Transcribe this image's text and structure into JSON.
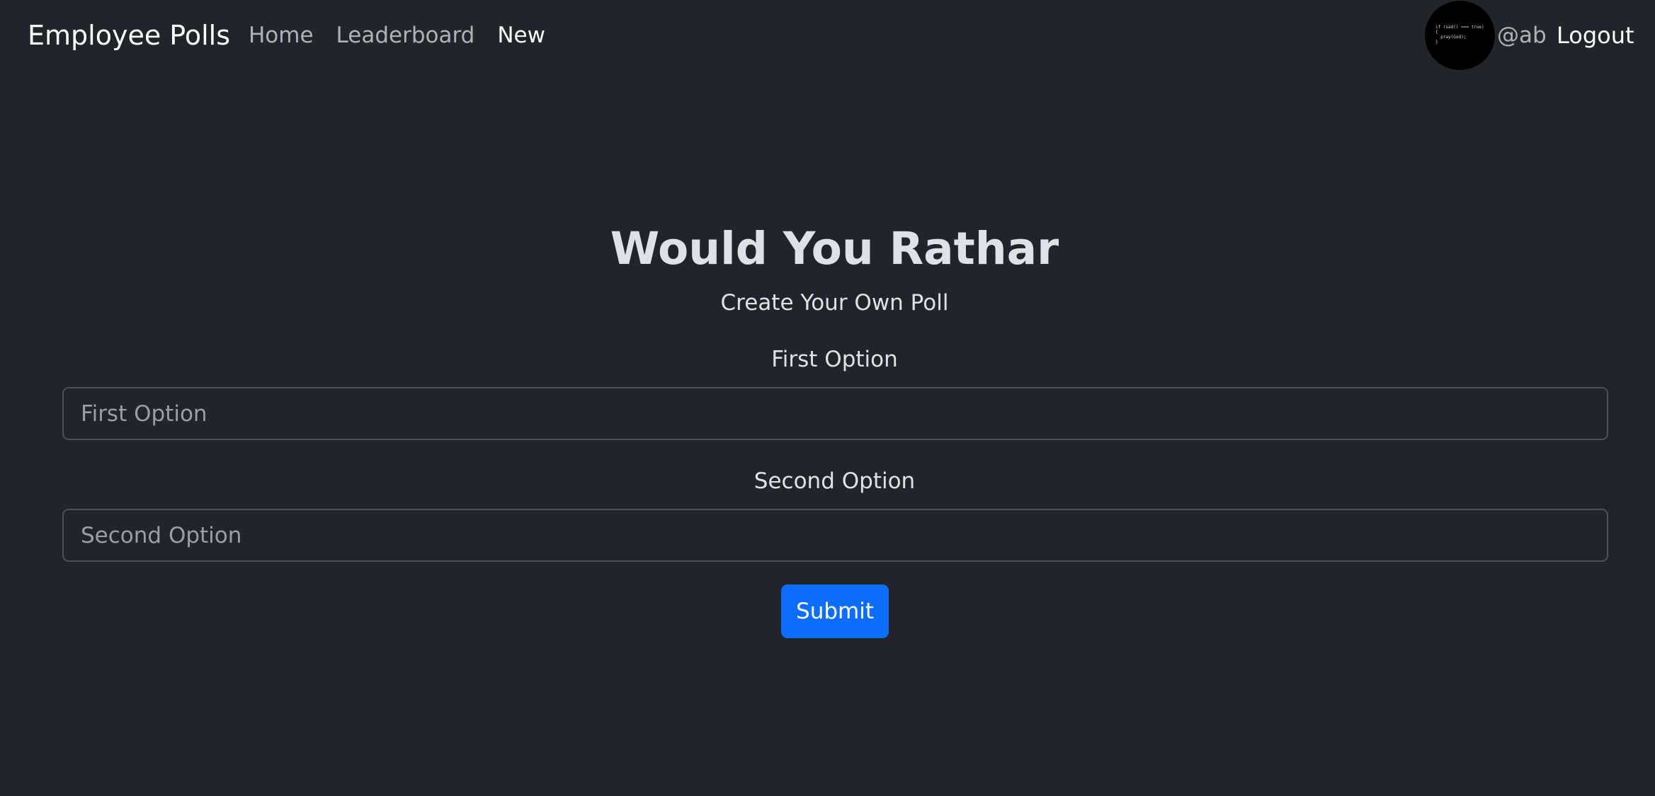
{
  "navbar": {
    "brand": "Employee Polls",
    "links": [
      {
        "label": "Home",
        "active": false
      },
      {
        "label": "Leaderboard",
        "active": false
      },
      {
        "label": "New",
        "active": true
      }
    ],
    "avatar_code_text": "if (sad() === true)\n{\n  pray(God);\n}",
    "username": "@ab",
    "logout_label": "Logout"
  },
  "main": {
    "title": "Would You Rathar",
    "subtitle": "Create Your Own Poll",
    "first_option": {
      "label": "First Option",
      "placeholder": "First Option",
      "value": ""
    },
    "second_option": {
      "label": "Second Option",
      "placeholder": "Second Option",
      "value": ""
    },
    "submit_label": "Submit"
  },
  "colors": {
    "background": "#212529",
    "text": "#dee2e6",
    "muted_text": "#999fa6",
    "input_border": "#495057",
    "primary": "#0d6efd",
    "avatar_bg": "#000000"
  }
}
